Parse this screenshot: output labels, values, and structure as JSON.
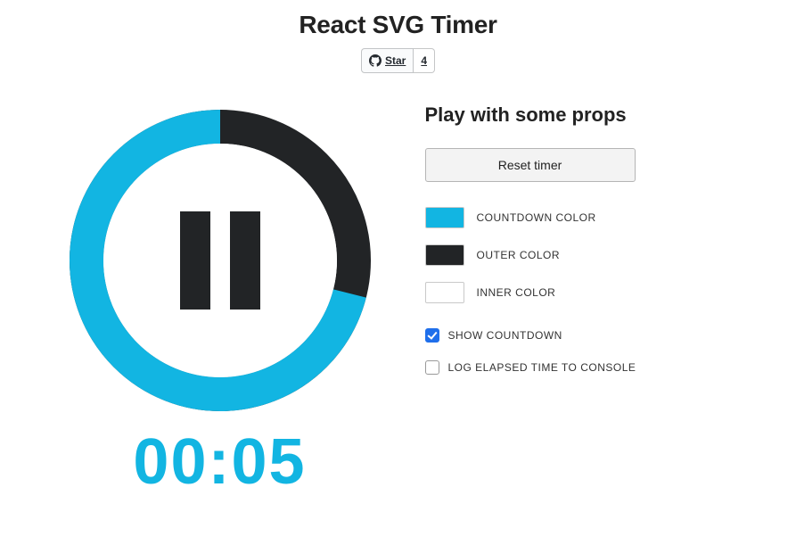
{
  "header": {
    "title": "React SVG Timer",
    "github": {
      "star_label": "Star",
      "star_count": "4"
    }
  },
  "timer": {
    "display": "00:05",
    "progress_fraction": 0.29,
    "state": "running"
  },
  "props_panel": {
    "heading": "Play with some props",
    "reset_label": "Reset timer",
    "colors": {
      "countdown": {
        "label": "COUNTDOWN COLOR",
        "value": "#12b5e2"
      },
      "outer": {
        "label": "OUTER COLOR",
        "value": "#222426"
      },
      "inner": {
        "label": "INNER COLOR",
        "value": "#ffffff"
      }
    },
    "checks": {
      "show_countdown": {
        "label": "SHOW COUNTDOWN",
        "checked": true
      },
      "log_elapsed": {
        "label": "LOG ELAPSED TIME TO CONSOLE",
        "checked": false
      }
    }
  }
}
